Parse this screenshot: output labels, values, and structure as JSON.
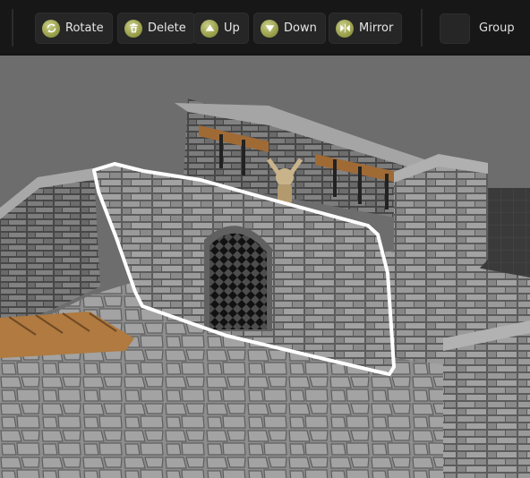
{
  "toolbar": {
    "buttons": [
      {
        "label": "Rotate",
        "icon": "rotate-icon"
      },
      {
        "label": "Delete",
        "icon": "trash-icon"
      },
      {
        "label": "Up",
        "icon": "arrow-up-icon"
      },
      {
        "label": "Down",
        "icon": "arrow-down-icon"
      },
      {
        "label": "Mirror",
        "icon": "mirror-icon"
      }
    ],
    "group_label": "Group"
  },
  "colors": {
    "toolbar_bg": "#171717",
    "button_bg": "#262626",
    "icon_accent": "#9da34f",
    "selection_outline": "#ffffff",
    "viewport_bg": "#6d6d6d"
  }
}
